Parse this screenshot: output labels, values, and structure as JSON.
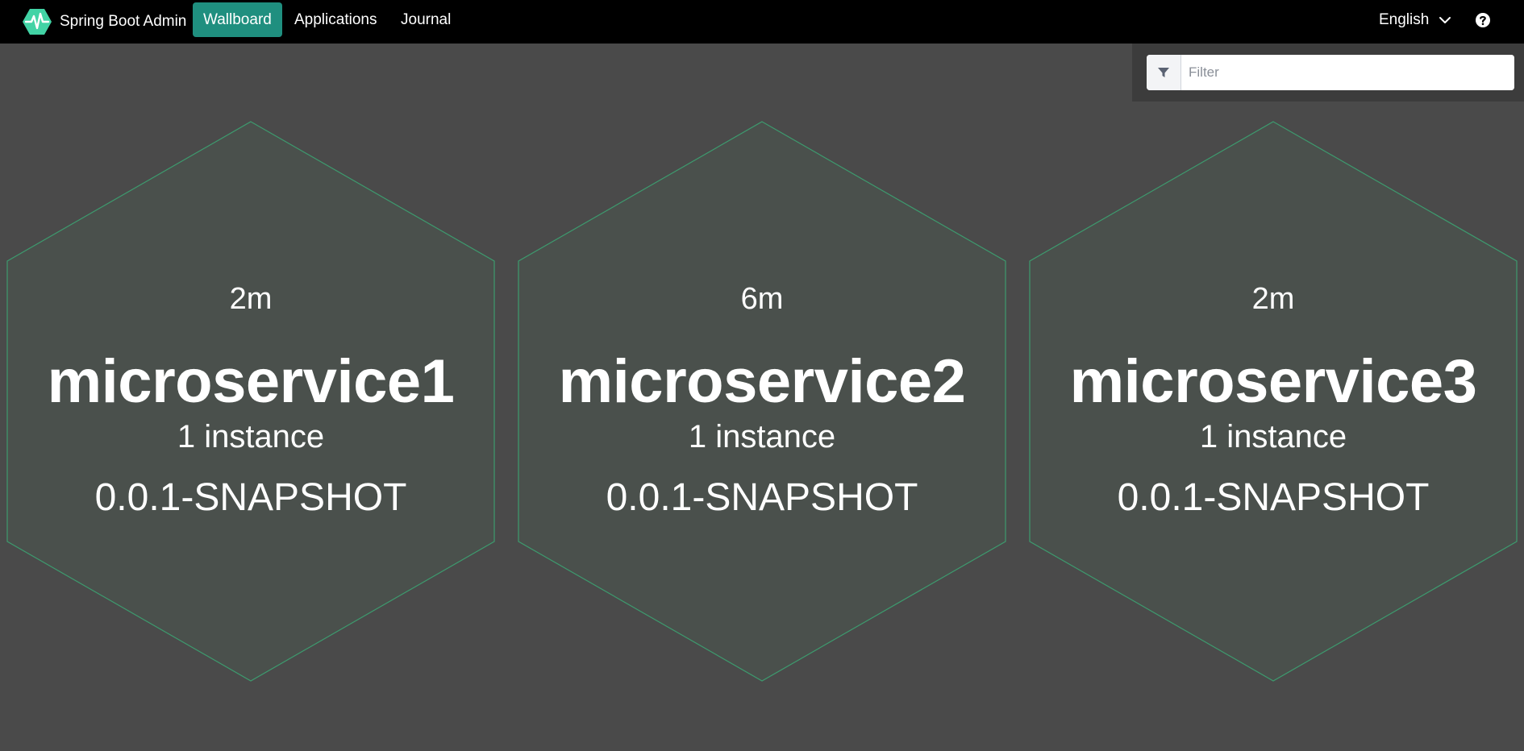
{
  "app": {
    "title": "Spring Boot Admin",
    "accent_color": "#1f8f7f",
    "logo_icon": "heartbeat-icon"
  },
  "nav": {
    "items": [
      {
        "label": "Wallboard",
        "active": true
      },
      {
        "label": "Applications",
        "active": false
      },
      {
        "label": "Journal",
        "active": false
      }
    ],
    "language": "English",
    "help_icon": "question-circle-icon"
  },
  "filter": {
    "placeholder": "Filter",
    "value": "",
    "icon": "filter-icon"
  },
  "applications": [
    {
      "uptime": "2m",
      "name": "microservice1",
      "instances": "1 instance",
      "version": "0.0.1-SNAPSHOT",
      "status_color": "#42d3a5"
    },
    {
      "uptime": "6m",
      "name": "microservice2",
      "instances": "1 instance",
      "version": "0.0.1-SNAPSHOT",
      "status_color": "#42d3a5"
    },
    {
      "uptime": "2m",
      "name": "microservice3",
      "instances": "1 instance",
      "version": "0.0.1-SNAPSHOT",
      "status_color": "#42d3a5"
    }
  ],
  "colors": {
    "navbar": "#000000",
    "background": "#4a4a4a",
    "hex_fill": "#4a504c",
    "hex_border": "#3d9a6e"
  }
}
